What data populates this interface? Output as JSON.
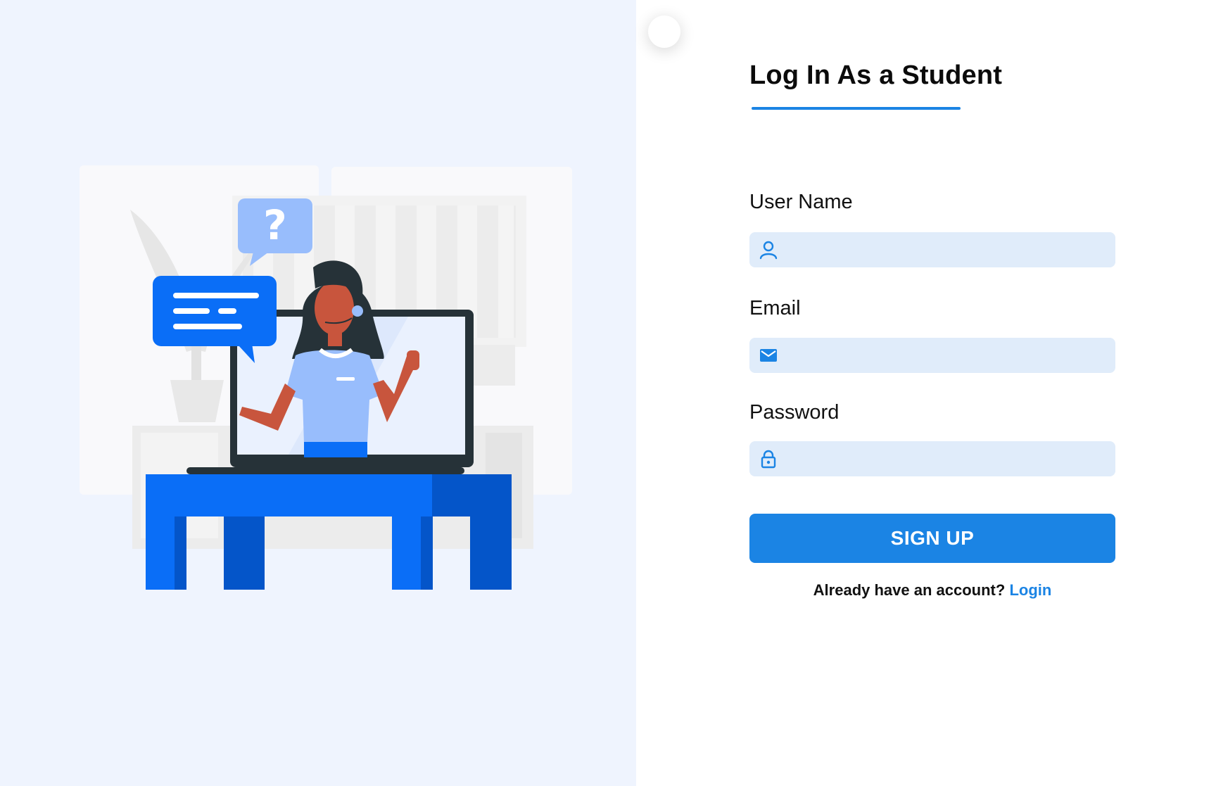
{
  "form": {
    "title": "Log In As a Student",
    "username": {
      "label": "User Name",
      "value": "",
      "placeholder": "",
      "icon": "user-icon"
    },
    "email": {
      "label": "Email",
      "value": "",
      "placeholder": "",
      "icon": "envelope-icon"
    },
    "password": {
      "label": "Password",
      "value": "",
      "placeholder": "",
      "icon": "lock-icon"
    },
    "submit_label": "SIGN UP",
    "login_prompt": "Already have an account?",
    "login_link": "Login"
  },
  "colors": {
    "accent": "#1b84e4",
    "left_background": "#eff4fe",
    "input_background": "#e0ecfa",
    "illustration_blue": "#0a6ef7",
    "illustration_light_blue": "#98bdfc"
  }
}
